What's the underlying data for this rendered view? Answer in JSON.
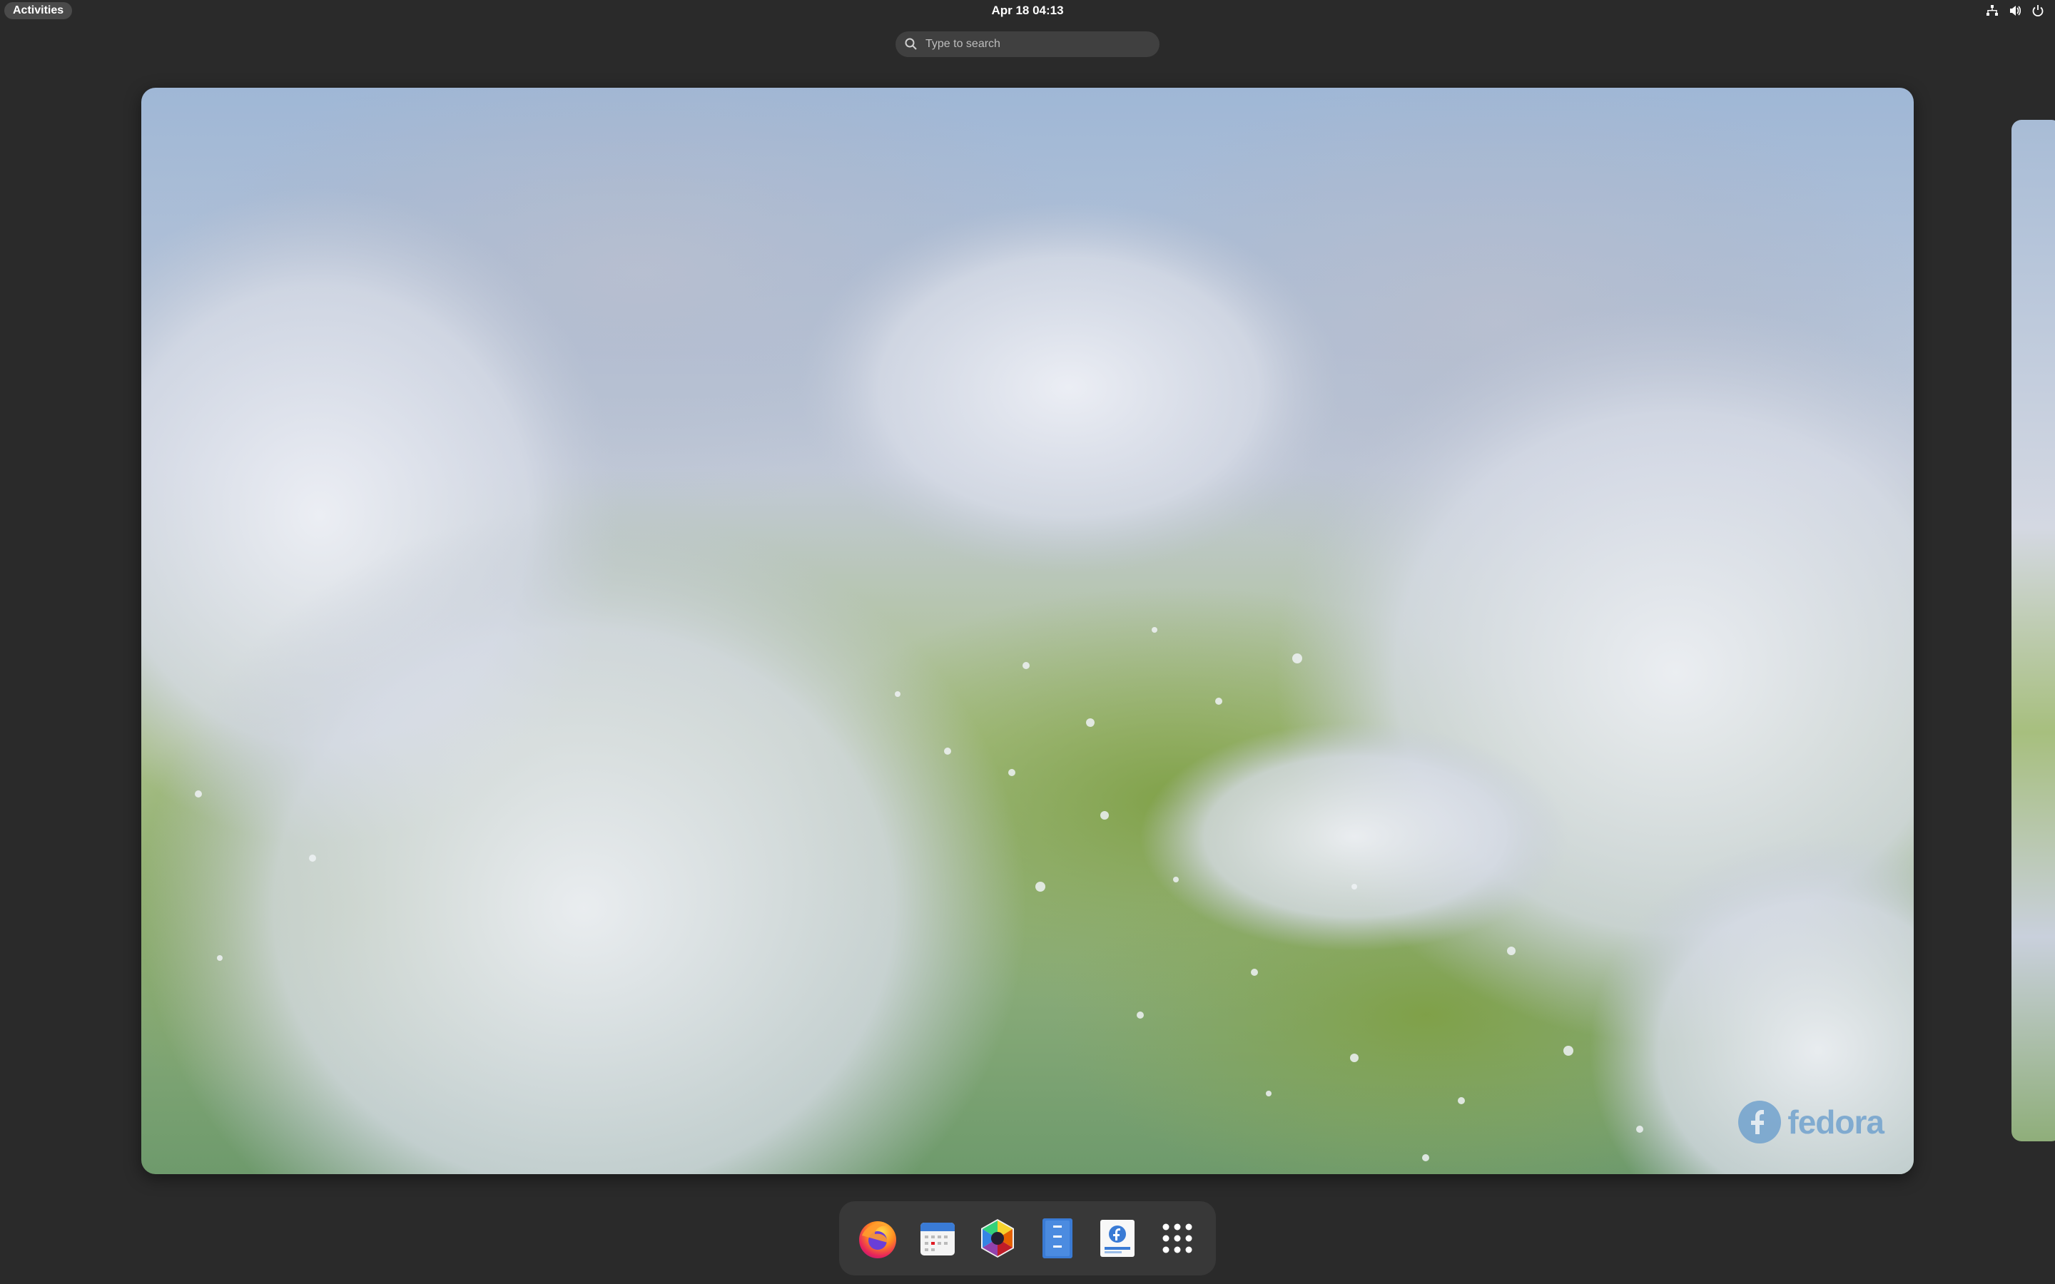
{
  "topbar": {
    "activities_label": "Activities",
    "clock": "Apr 18  04:13",
    "tray_icons": [
      "network-icon",
      "volume-icon",
      "power-icon"
    ]
  },
  "search": {
    "placeholder": "Type to search"
  },
  "workspace": {
    "wallpaper_logo_text": "fedora"
  },
  "dash": {
    "apps": [
      {
        "name": "Firefox",
        "icon": "firefox-icon"
      },
      {
        "name": "Calendar",
        "icon": "calendar-icon"
      },
      {
        "name": "Software",
        "icon": "software-icon"
      },
      {
        "name": "Text Editor",
        "icon": "text-editor-icon"
      },
      {
        "name": "Fedora Media Writer",
        "icon": "fedora-docs-icon"
      },
      {
        "name": "Show Applications",
        "icon": "app-grid-icon"
      }
    ]
  },
  "colors": {
    "panel": "#2a2a2a",
    "dash": "#383838",
    "accent_blue": "#3a7bd5"
  }
}
